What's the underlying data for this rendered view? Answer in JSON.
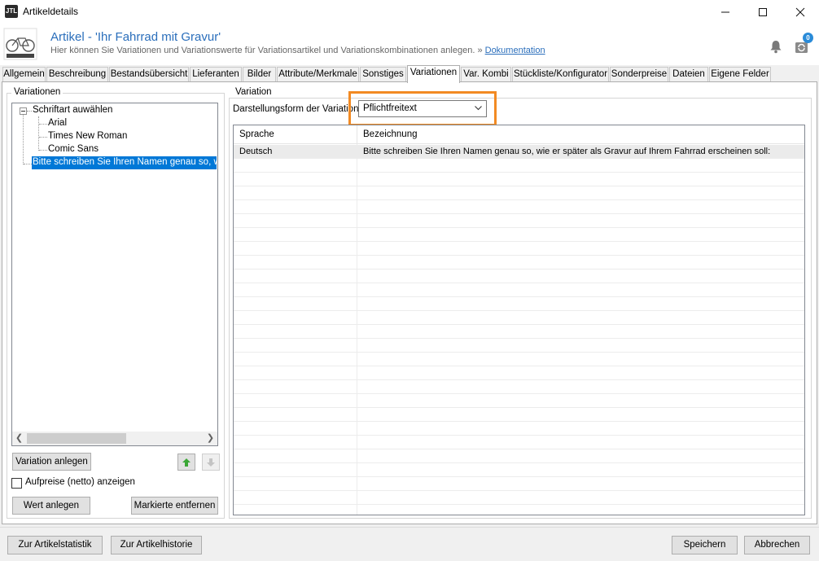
{
  "window": {
    "title": "Artikeldetails",
    "app_icon_text": "JTL",
    "minimize_icon": "minimize-icon",
    "maximize_icon": "maximize-icon",
    "close_icon": "close-icon"
  },
  "header": {
    "title": "Artikel - 'Ihr Fahrrad mit Gravur'",
    "subtitle": "Hier können Sie Variationen und Variationswerte für Variationsartikel und Variationskombinationen anlegen. » ",
    "doc_link": "Dokumentation",
    "notification_count": "0"
  },
  "tabs": [
    {
      "label": "Allgemein"
    },
    {
      "label": "Beschreibung"
    },
    {
      "label": "Bestandsübersicht"
    },
    {
      "label": "Lieferanten"
    },
    {
      "label": "Bilder"
    },
    {
      "label": "Attribute/Merkmale"
    },
    {
      "label": "Sonstiges"
    },
    {
      "label": "Variationen"
    },
    {
      "label": "Var. Kombi"
    },
    {
      "label": "Stückliste/Konfigurator"
    },
    {
      "label": "Sonderpreise"
    },
    {
      "label": "Dateien"
    },
    {
      "label": "Eigene Felder"
    }
  ],
  "left": {
    "group_label": "Variationen",
    "tree": {
      "root": "Schriftart auwählen",
      "children": [
        "Arial",
        "Times New Roman",
        "Comic Sans"
      ],
      "selected": "Bitte schreiben Sie Ihren Namen genau so, wie er später als Gravur auf Ihrem Fahrrad erscheinen soll:"
    },
    "add_variation_button": "Variation anlegen",
    "up_icon": "arrow-up-icon",
    "down_icon": "arrow-down-icon",
    "checkbox_label": "Aufpreise (netto) anzeigen",
    "checkbox_checked": false,
    "add_value_button": "Wert anlegen",
    "remove_marked_button": "Markierte entfernen"
  },
  "right": {
    "group_label": "Variation",
    "display_form_label": "Darstellungsform der Variation:",
    "display_form_value": "Pflichtfreitext",
    "grid": {
      "columns": [
        "Sprache",
        "Bezeichnung"
      ],
      "rows": [
        [
          "Deutsch",
          "Bitte schreiben Sie Ihren Namen genau so, wie er später als Gravur auf Ihrem Fahrrad erscheinen soll:"
        ]
      ]
    }
  },
  "footer": {
    "stats_button": "Zur Artikelstatistik",
    "history_button": "Zur Artikelhistorie",
    "save_button": "Speichern",
    "cancel_button": "Abbrechen"
  },
  "colors": {
    "accent": "#2a6ebb",
    "selection": "#0078d7",
    "highlight": "#f28a23"
  }
}
